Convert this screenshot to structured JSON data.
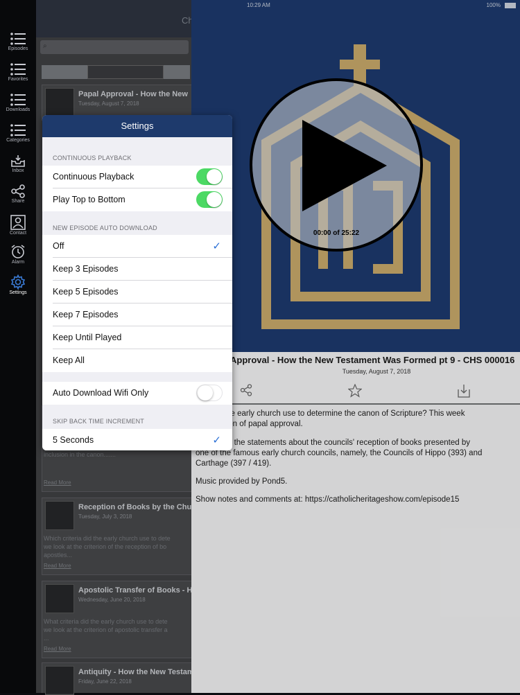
{
  "sidebar": {
    "items": [
      {
        "label": "Episodes",
        "icon": "list-icon"
      },
      {
        "label": "Favorites",
        "icon": "list-icon"
      },
      {
        "label": "Downloads",
        "icon": "list-icon"
      },
      {
        "label": "Categories",
        "icon": "list-icon"
      },
      {
        "label": "Inbox",
        "icon": "inbox-icon"
      },
      {
        "label": "Share",
        "icon": "share-icon"
      },
      {
        "label": "Contact",
        "icon": "contact-icon"
      },
      {
        "label": "Alarm",
        "icon": "alarm-icon"
      },
      {
        "label": "Settings",
        "icon": "gear-icon"
      }
    ],
    "active": "Settings"
  },
  "list": {
    "nav_title": "Ch",
    "episodes": [
      {
        "title": "Papal Approval - How the New",
        "date": "Tuesday, August 7, 2018",
        "desc": "",
        "more": ""
      },
      {
        "title": "",
        "date": "",
        "desc": "which criteria did the early church use to det\nwe look at the criterion of the orthodox chara\ninclusion in the canon.......",
        "more": "Read More"
      },
      {
        "title": "Reception of Books by the Chu",
        "date": "Tuesday, July 3, 2018",
        "desc": "Which criteria did the early church use to dete\nwe look at the criterion of the reception of bo\napostles...",
        "more": "Read More"
      },
      {
        "title": "Apostolic Transfer of Books - H",
        "date": "Wednesday, June 20, 2018",
        "desc": "What criteria did the early church use to dete\nwe look at the criterion of apostolic transfer a\n...",
        "more": "Read More"
      },
      {
        "title": "Antiquity - How the New Testam",
        "date": "Friday, June 22, 2018",
        "desc": "",
        "more": ""
      }
    ]
  },
  "status": {
    "time": "10:29 AM",
    "battery": "100%"
  },
  "player": {
    "time_display": "00:00 of 25:22"
  },
  "detail": {
    "title": "Approval - How the New Testament Was Formed pt 9 - CHS 000016",
    "date": "Tuesday, August 7, 2018",
    "paragraphs": [
      "eria did the early church use to determine the canon of Scripture? This week\nthe criterion of papal approval.",
      "s primarily the statements about the councils' reception of books presented by\none of the famous early church councils, namely, the Councils of Hippo (393) and\nCarthage (397 / 419).",
      "Music provided by Pond5.",
      "Show notes and comments at: https://catholicheritageshow.com/episode15"
    ]
  },
  "settings": {
    "title": "Settings",
    "sections": {
      "continuous": "CONTINUOUS PLAYBACK",
      "auto_download": "NEW EPISODE AUTO DOWNLOAD",
      "skip_back": "SKIP BACK TIME INCREMENT"
    },
    "continuous_playback": {
      "label": "Continuous Playback",
      "on": true
    },
    "play_top_to_bottom": {
      "label": "Play Top to Bottom",
      "on": true
    },
    "download_options": [
      {
        "label": "Off",
        "selected": true
      },
      {
        "label": "Keep 3 Episodes",
        "selected": false
      },
      {
        "label": "Keep 5 Episodes",
        "selected": false
      },
      {
        "label": "Keep 7 Episodes",
        "selected": false
      },
      {
        "label": "Keep Until Played",
        "selected": false
      },
      {
        "label": "Keep All",
        "selected": false
      }
    ],
    "wifi_only": {
      "label": "Auto Download Wifi Only",
      "on": false
    },
    "skip_back": {
      "label": "5 Seconds",
      "selected": true
    }
  },
  "colors": {
    "brand": "#1d3a6e",
    "toggle_on": "#4cd964",
    "checkmark": "#2a6fd6",
    "logo_gold": "#c8a96a"
  }
}
